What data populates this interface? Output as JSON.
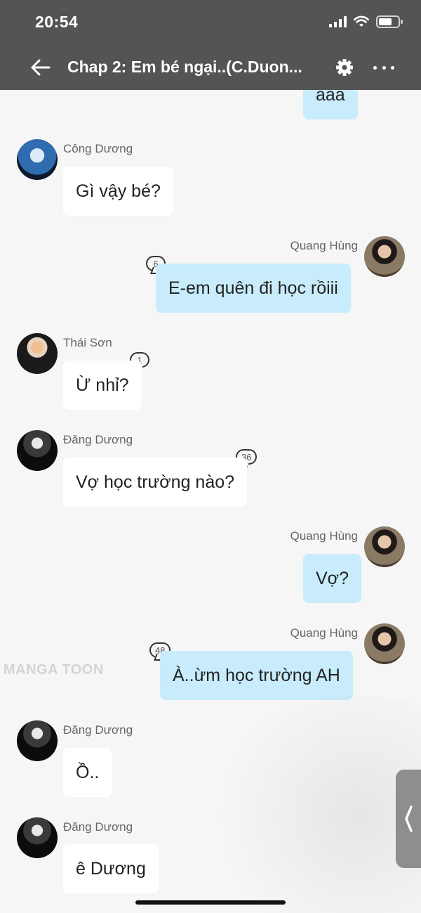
{
  "status_bar": {
    "time": "20:54"
  },
  "header": {
    "title": "Chap 2: Em bé ngại..(C.Duon..."
  },
  "watermark": "MANGA TOON",
  "messages": [
    {
      "side": "right",
      "text": "aaa"
    },
    {
      "side": "left",
      "sender": "Công Dương",
      "text": "Gì vậy bé?"
    },
    {
      "side": "right",
      "sender": "Quang Hùng",
      "text": "E-em quên đi học rồiii",
      "comments": "6"
    },
    {
      "side": "left",
      "sender": "Thái Sơn",
      "text": "Ừ nhỉ?",
      "comments": "1"
    },
    {
      "side": "left",
      "sender": "Đăng Dương",
      "text": "Vợ học trường nào?",
      "comments": "36"
    },
    {
      "side": "right",
      "sender": "Quang Hùng",
      "text": "Vợ?"
    },
    {
      "side": "right",
      "sender": "Quang Hùng",
      "text": "À..ừm học trường AH",
      "comments": "48"
    },
    {
      "side": "left",
      "sender": "Đăng Dương",
      "text": "Ồ.."
    },
    {
      "side": "left",
      "sender": "Đăng Dương",
      "text": "ê Dương"
    }
  ],
  "colors": {
    "header_bg": "#545454",
    "left_bubble": "#ffffff",
    "right_bubble": "#c8ecfb",
    "background": "#f6f6f6"
  }
}
